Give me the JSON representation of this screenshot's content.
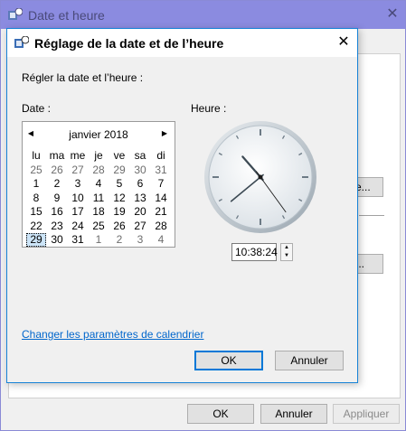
{
  "parent": {
    "title": "Date et heure",
    "partial_button_1": "e...",
    "partial_button_2": "...",
    "buttons": {
      "ok": "OK",
      "cancel": "Annuler",
      "apply": "Appliquer"
    }
  },
  "dialog": {
    "title": "Réglage de la date et de l’heure",
    "instruction": "Régler la date et l’heure :",
    "date_label": "Date :",
    "time_label": "Heure :",
    "calendar": {
      "month": "janvier 2018",
      "weekdays": [
        "lu",
        "ma",
        "me",
        "je",
        "ve",
        "sa",
        "di"
      ],
      "weeks": [
        [
          "25",
          "26",
          "27",
          "28",
          "29",
          "30",
          "31"
        ],
        [
          "1",
          "2",
          "3",
          "4",
          "5",
          "6",
          "7"
        ],
        [
          "8",
          "9",
          "10",
          "11",
          "12",
          "13",
          "14"
        ],
        [
          "15",
          "16",
          "17",
          "18",
          "19",
          "20",
          "21"
        ],
        [
          "22",
          "23",
          "24",
          "25",
          "26",
          "27",
          "28"
        ],
        [
          "29",
          "30",
          "31",
          "1",
          "2",
          "3",
          "4"
        ]
      ],
      "selected_day": "29"
    },
    "time_value": "10:38:24",
    "calendar_link": "Changer les paramètres de calendrier",
    "buttons": {
      "ok": "OK",
      "cancel": "Annuler"
    }
  },
  "colors": {
    "accent": "#0078d7",
    "parent_titlebar": "#8b8be0",
    "link": "#0066cc"
  },
  "icons": [
    "clock-app-icon",
    "close-icon",
    "prev-month-icon",
    "next-month-icon",
    "spin-up-icon",
    "spin-down-icon"
  ]
}
